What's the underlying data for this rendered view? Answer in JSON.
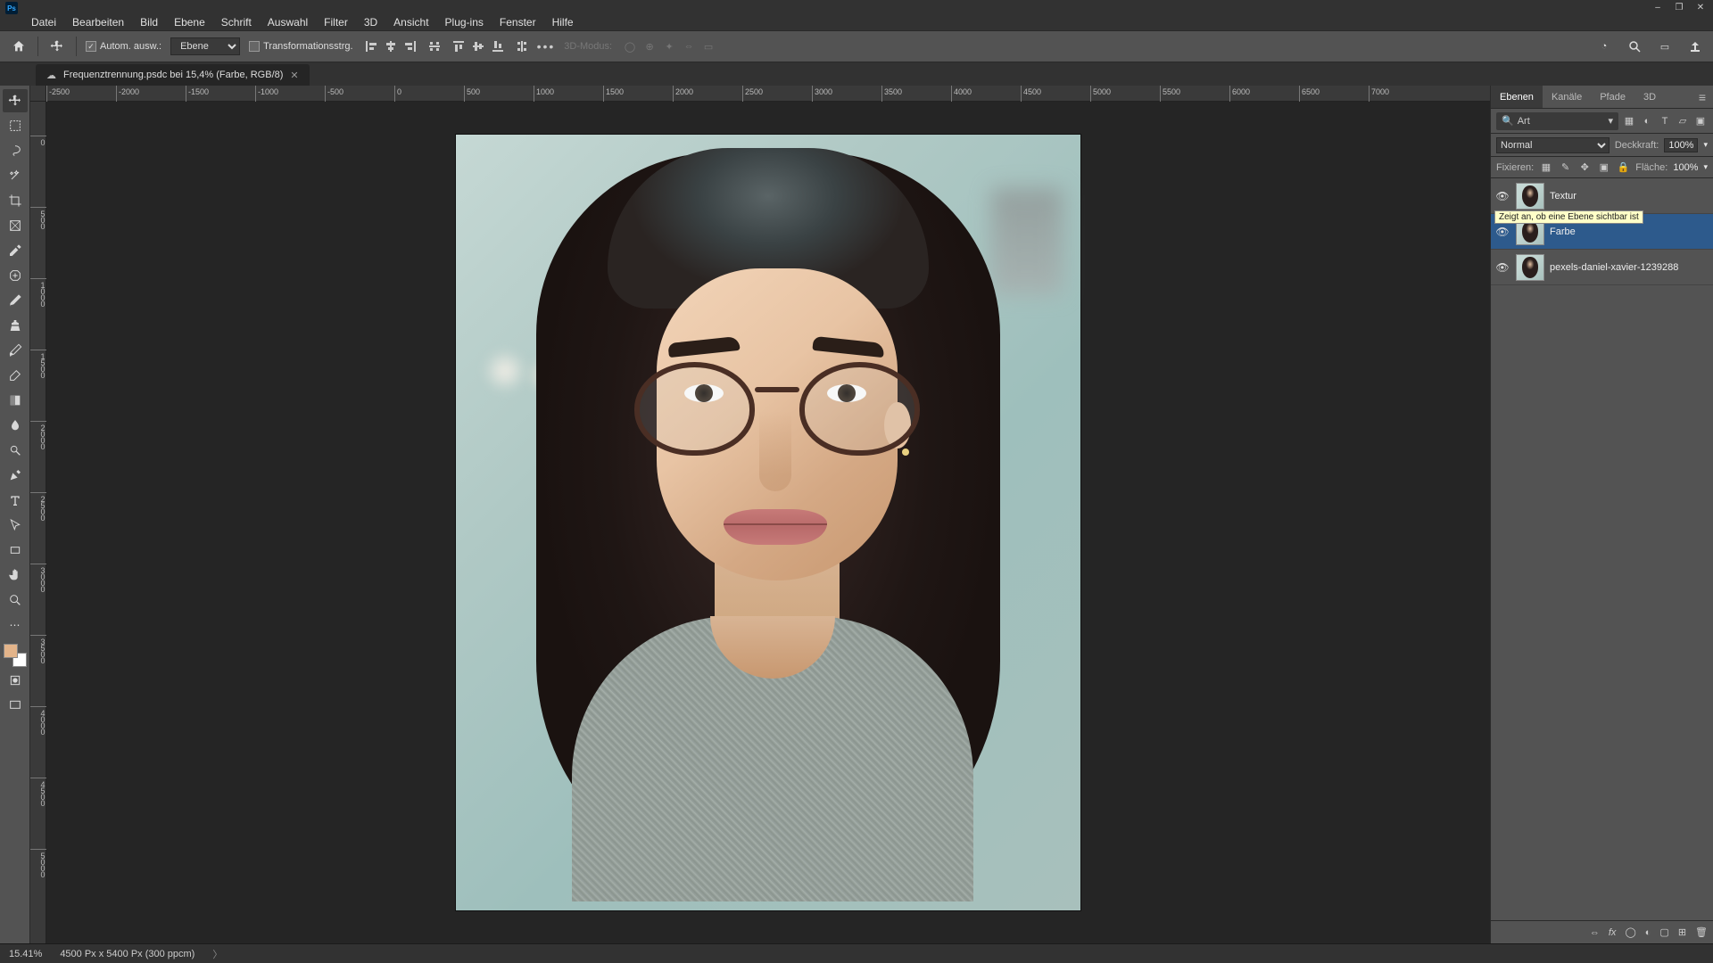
{
  "window": {
    "minimize": "–",
    "maximize": "❐",
    "close": "✕"
  },
  "menubar": [
    "Datei",
    "Bearbeiten",
    "Bild",
    "Ebene",
    "Schrift",
    "Auswahl",
    "Filter",
    "3D",
    "Ansicht",
    "Plug-ins",
    "Fenster",
    "Hilfe"
  ],
  "optbar": {
    "auto_select_label": "Autom. ausw.:",
    "layer_select": "Ebene",
    "transform_label": "Transformationsstrg.",
    "mode3d_label": "3D-Modus:",
    "dots": "•••"
  },
  "tab": {
    "title": "Frequenztrennung.psdc bei 15,4% (Farbe, RGB/8)"
  },
  "ruler_h": [
    "-2500",
    "-2000",
    "-1500",
    "-1000",
    "-500",
    "0",
    "500",
    "1000",
    "1500",
    "2000",
    "2500",
    "3000",
    "3500",
    "4000",
    "4500",
    "5000",
    "5500",
    "6000",
    "6500",
    "7000"
  ],
  "ruler_v": [
    "0",
    "500",
    "1000",
    "1500",
    "2000",
    "2500",
    "3000",
    "3500",
    "4000",
    "4500",
    "5000"
  ],
  "rightpanel": {
    "tabs": [
      "Ebenen",
      "Kanäle",
      "Pfade",
      "3D"
    ],
    "search_placeholder": "Art",
    "blend_mode": "Normal",
    "opacity_label": "Deckkraft:",
    "opacity_value": "100%",
    "lock_label": "Fixieren:",
    "fill_label": "Fläche:",
    "fill_value": "100%",
    "tooltip": "Zeigt an, ob eine Ebene sichtbar ist",
    "layers": [
      {
        "name": "Textur",
        "visible": true,
        "selected": false
      },
      {
        "name": "Farbe",
        "visible": true,
        "selected": true
      },
      {
        "name": "pexels-daniel-xavier-1239288",
        "visible": true,
        "selected": false
      }
    ]
  },
  "status": {
    "zoom": "15.41%",
    "docinfo": "4500 Px x 5400 Px (300 ppcm)"
  },
  "swatch": {
    "fg": "#e3b48a",
    "bg": "#ffffff"
  }
}
